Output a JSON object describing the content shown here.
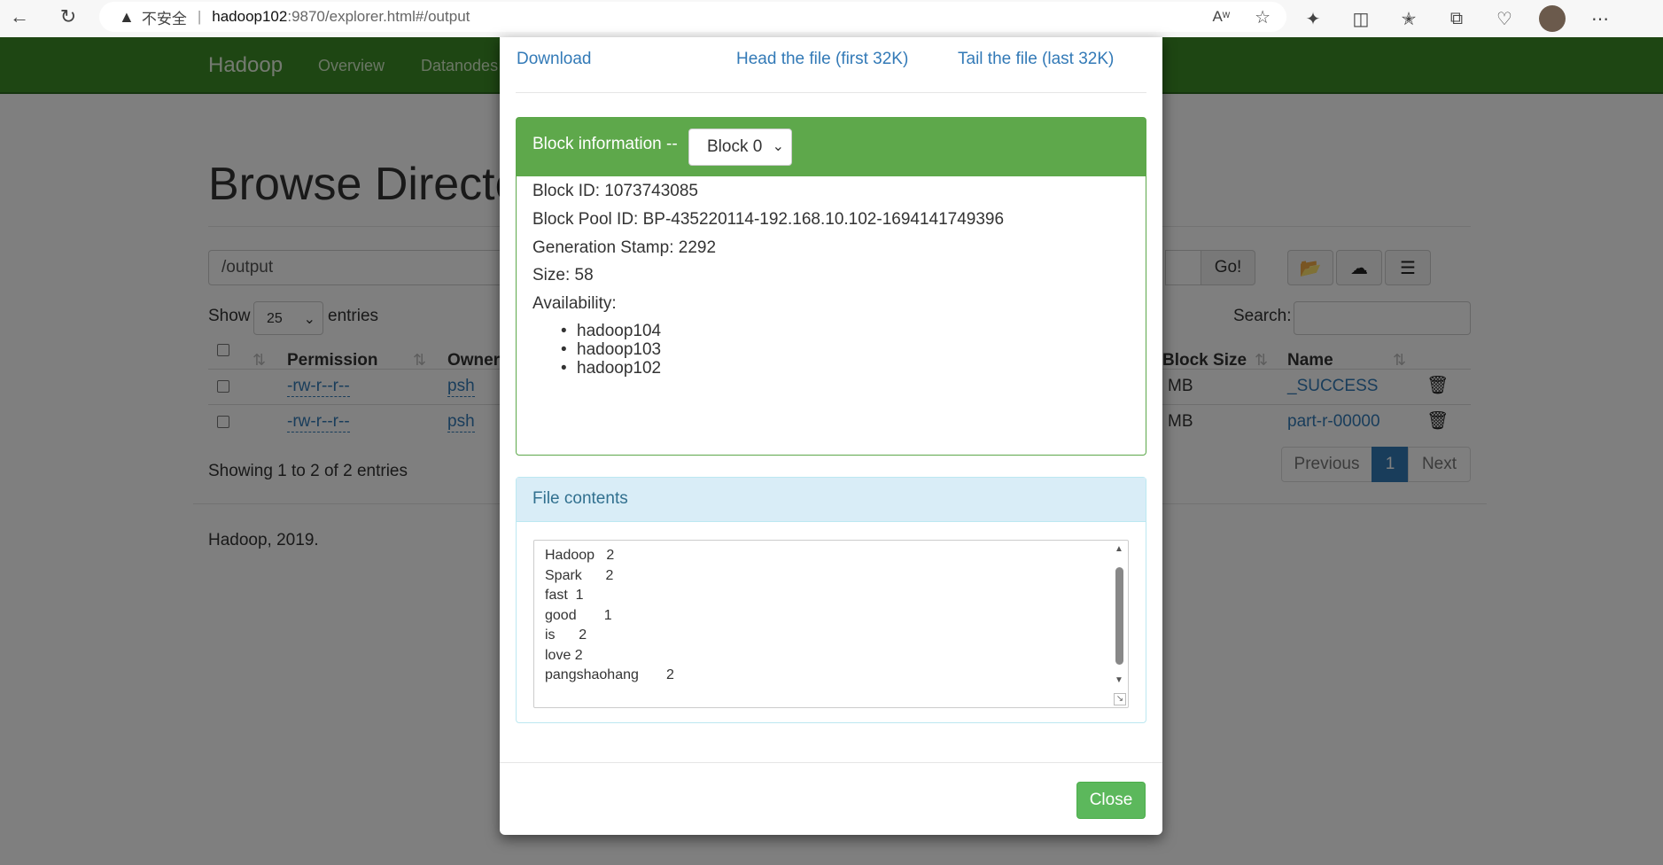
{
  "browser": {
    "security_label": "不安全",
    "url_host": "hadoop102",
    "url_rest": ":9870/explorer.html#/output"
  },
  "navbar": {
    "brand": "Hadoop",
    "links": [
      "Overview",
      "Datanodes"
    ]
  },
  "page": {
    "title": "Browse Directory",
    "path_value": "/output",
    "go_label": "Go!",
    "show_label": "Show",
    "entries_select": "25",
    "entries_label": "entries",
    "search_label": "Search:",
    "columns": [
      "Permission",
      "Owner",
      "Block Size",
      "Name"
    ],
    "rows": [
      {
        "permission": "-rw-r--r--",
        "owner": "psh",
        "block_size": "MB",
        "name": "_SUCCESS"
      },
      {
        "permission": "-rw-r--r--",
        "owner": "psh",
        "block_size": "MB",
        "name": "part-r-00000"
      }
    ],
    "showing_text": "Showing 1 to 2 of 2 entries",
    "pager": {
      "previous": "Previous",
      "current": "1",
      "next": "Next"
    },
    "footer": "Hadoop, 2019."
  },
  "modal": {
    "download": "Download",
    "head": "Head the file (first 32K)",
    "tail": "Tail the file (last 32K)",
    "block_info_label": "Block information --",
    "block_select": "Block 0",
    "block_id": "Block ID: 1073743085",
    "block_pool_id": "Block Pool ID: BP-435220114-192.168.10.102-1694141749396",
    "generation_stamp": "Generation Stamp: 2292",
    "size": "Size: 58",
    "availability_label": "Availability:",
    "availability": [
      "hadoop104",
      "hadoop103",
      "hadoop102"
    ],
    "file_contents_label": "File contents",
    "file_lines": [
      "Hadoop   2",
      "Spark      2",
      "fast  1",
      "good       1",
      "is      2",
      "love 2",
      "pangshaohang       2"
    ],
    "close": "Close"
  }
}
